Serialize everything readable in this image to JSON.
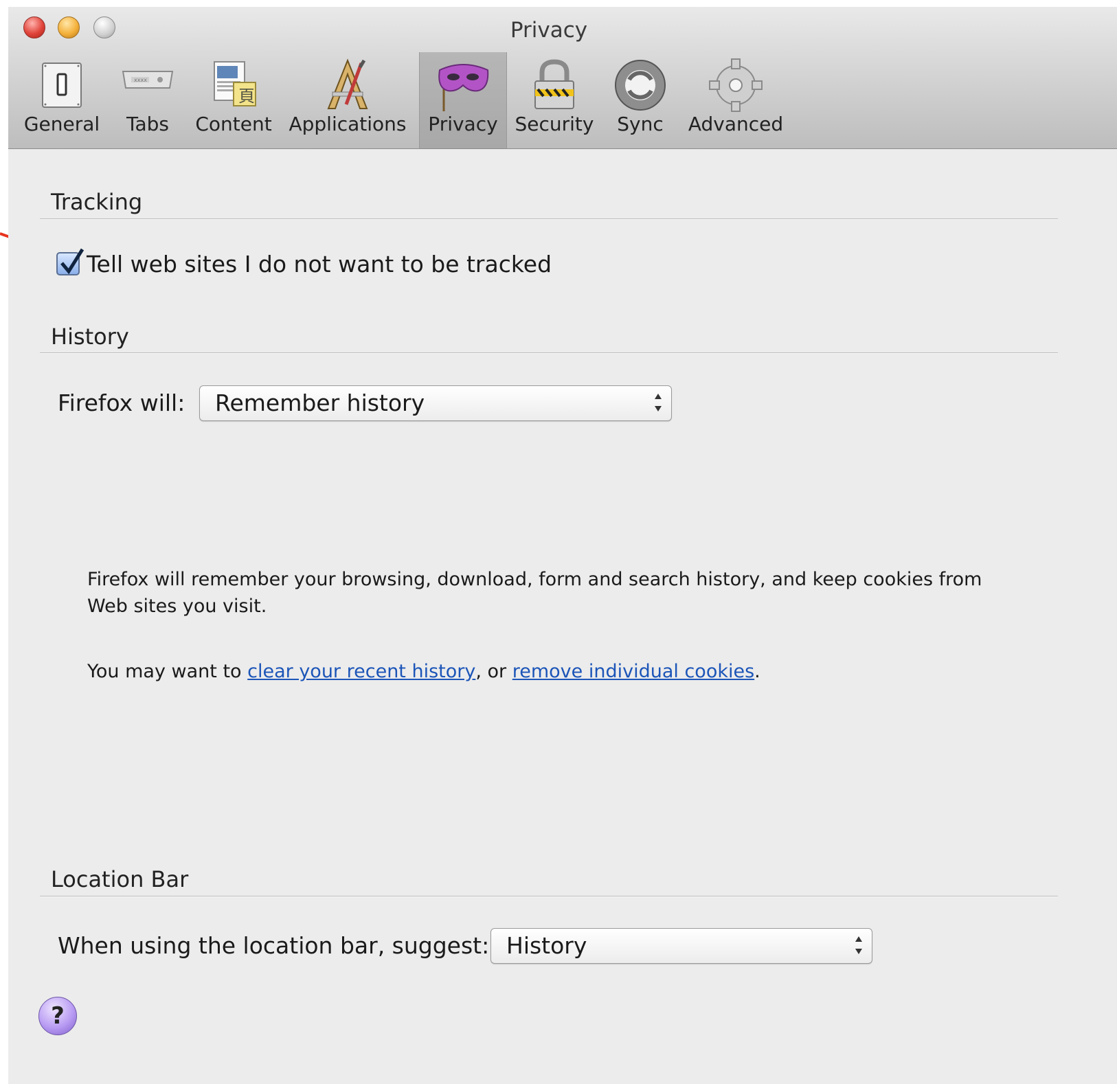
{
  "window": {
    "title": "Privacy"
  },
  "toolbar": {
    "items": [
      {
        "label": "General",
        "icon": "general-switch-icon"
      },
      {
        "label": "Tabs",
        "icon": "tabs-icon"
      },
      {
        "label": "Content",
        "icon": "content-icon"
      },
      {
        "label": "Applications",
        "icon": "applications-icon"
      },
      {
        "label": "Privacy",
        "icon": "privacy-mask-icon",
        "selected": true
      },
      {
        "label": "Security",
        "icon": "padlock-icon"
      },
      {
        "label": "Sync",
        "icon": "sync-icon"
      },
      {
        "label": "Advanced",
        "icon": "gear-icon"
      }
    ]
  },
  "tracking": {
    "heading": "Tracking",
    "checkbox_label": "Tell web sites I do not want to be tracked",
    "checked": true
  },
  "history": {
    "heading": "History",
    "firefox_will_label": "Firefox will:",
    "mode_value": "Remember history",
    "description": "Firefox will remember your browsing, download, form and search history, and keep cookies from",
    "description_line2": "Web sites you visit.",
    "may_want_prefix": "You may want to",
    "clear_link": "clear your recent history",
    "or_text": ", or",
    "cookies_link": "remove individual cookies",
    "end_period": "."
  },
  "location_bar": {
    "heading": "Location Bar",
    "suggest_label": "When using the location bar, suggest:",
    "suggest_value": "History"
  },
  "help": {
    "label": "?"
  },
  "colors": {
    "link": "#1c55b8",
    "annotation_arrow": "#e8321e",
    "selected_tab": "#aeaeae"
  }
}
